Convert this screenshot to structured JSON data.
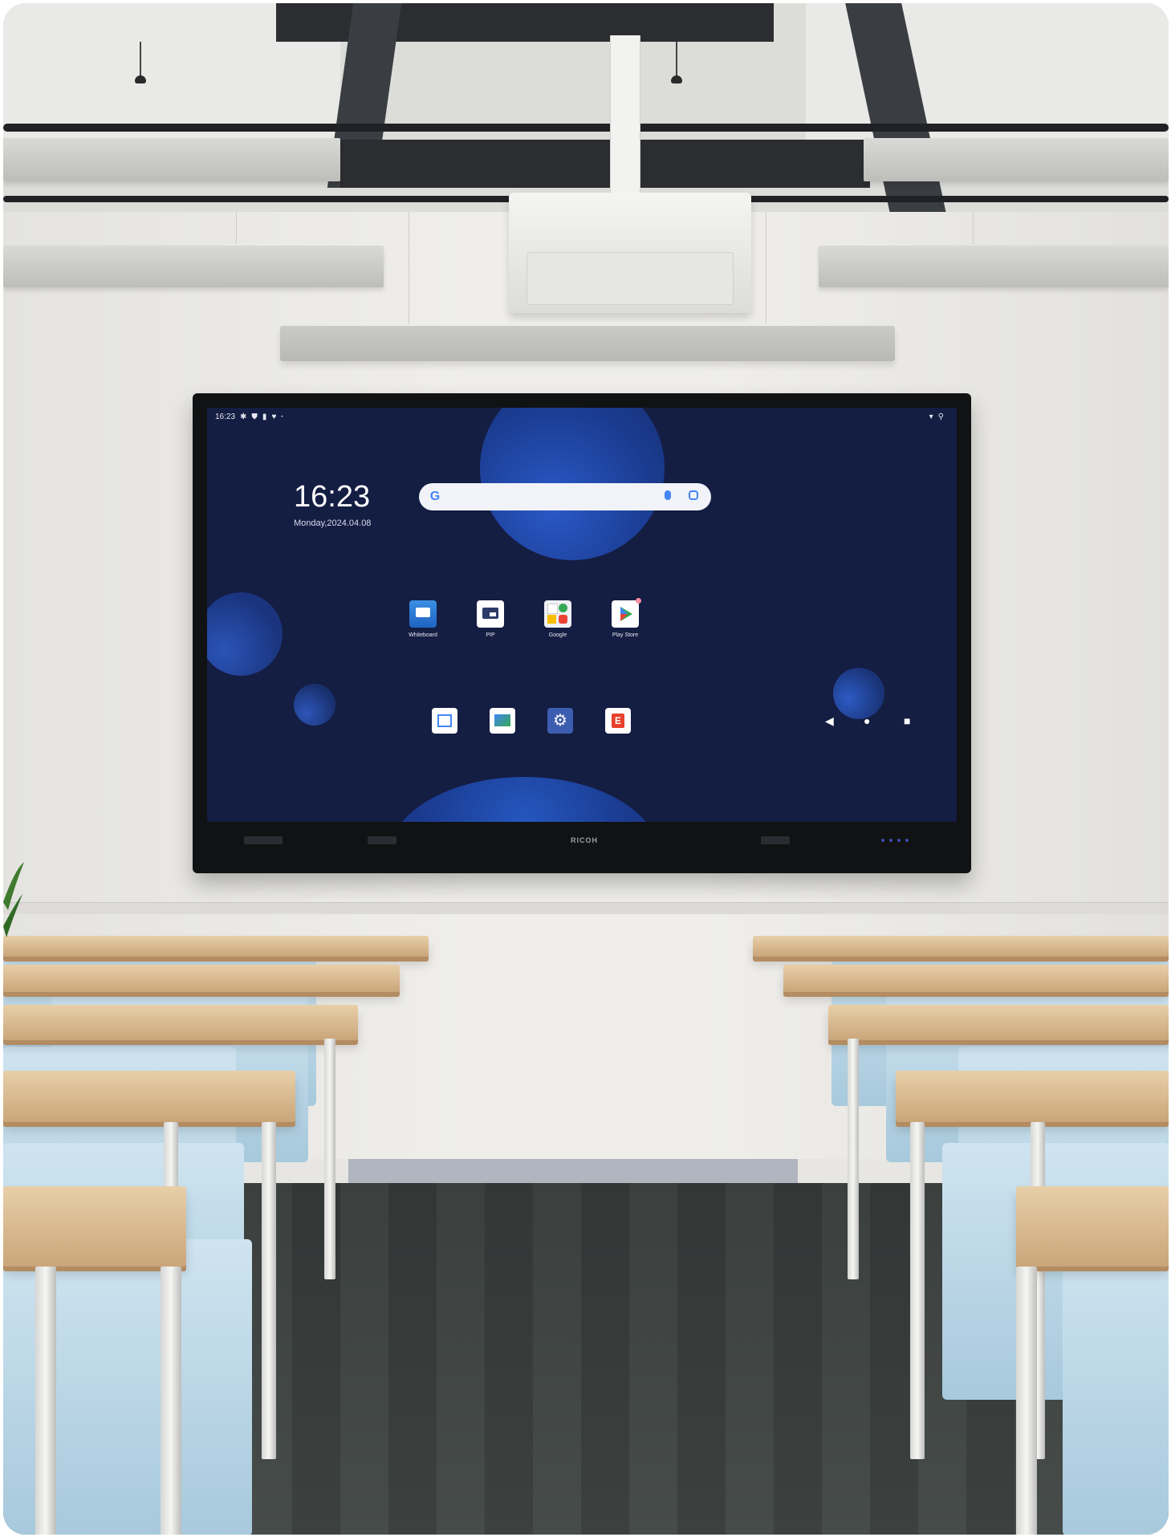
{
  "status_bar": {
    "time": "16:23",
    "left_icons": [
      "settings-icon",
      "shield-icon",
      "sd-card-icon",
      "security-icon",
      "dot-icon"
    ],
    "right_icons": [
      "wifi-icon",
      "battery-icon"
    ]
  },
  "clock_widget": {
    "time": "16:23",
    "date": "Monday,2024.04.08"
  },
  "search": {
    "logo": "G",
    "icons": [
      "google-g-icon",
      "microphone-icon",
      "lens-icon"
    ]
  },
  "apps": [
    {
      "label": "Whiteboard",
      "icon": "whiteboard-icon",
      "color": "#2b7fd9"
    },
    {
      "label": "PIP",
      "icon": "pip-icon",
      "color": "#ffffff"
    },
    {
      "label": "Google",
      "icon": "google-folder-icon",
      "color": "#ffffff"
    },
    {
      "label": "Play Store",
      "icon": "play-store-icon",
      "color": "#ffffff"
    }
  ],
  "dock": [
    "calendar-icon",
    "gallery-icon",
    "settings-icon",
    "e-app-icon"
  ],
  "nav": {
    "back": "◀",
    "home": "●",
    "recents": "■"
  },
  "bezel": {
    "brand": "RICOH"
  },
  "colors": {
    "screen_bg": "#141d42",
    "orb": "#1d3d8f",
    "wall": "#efeeea",
    "desk": "#d9b88c",
    "chair": "#b5d4e6"
  }
}
